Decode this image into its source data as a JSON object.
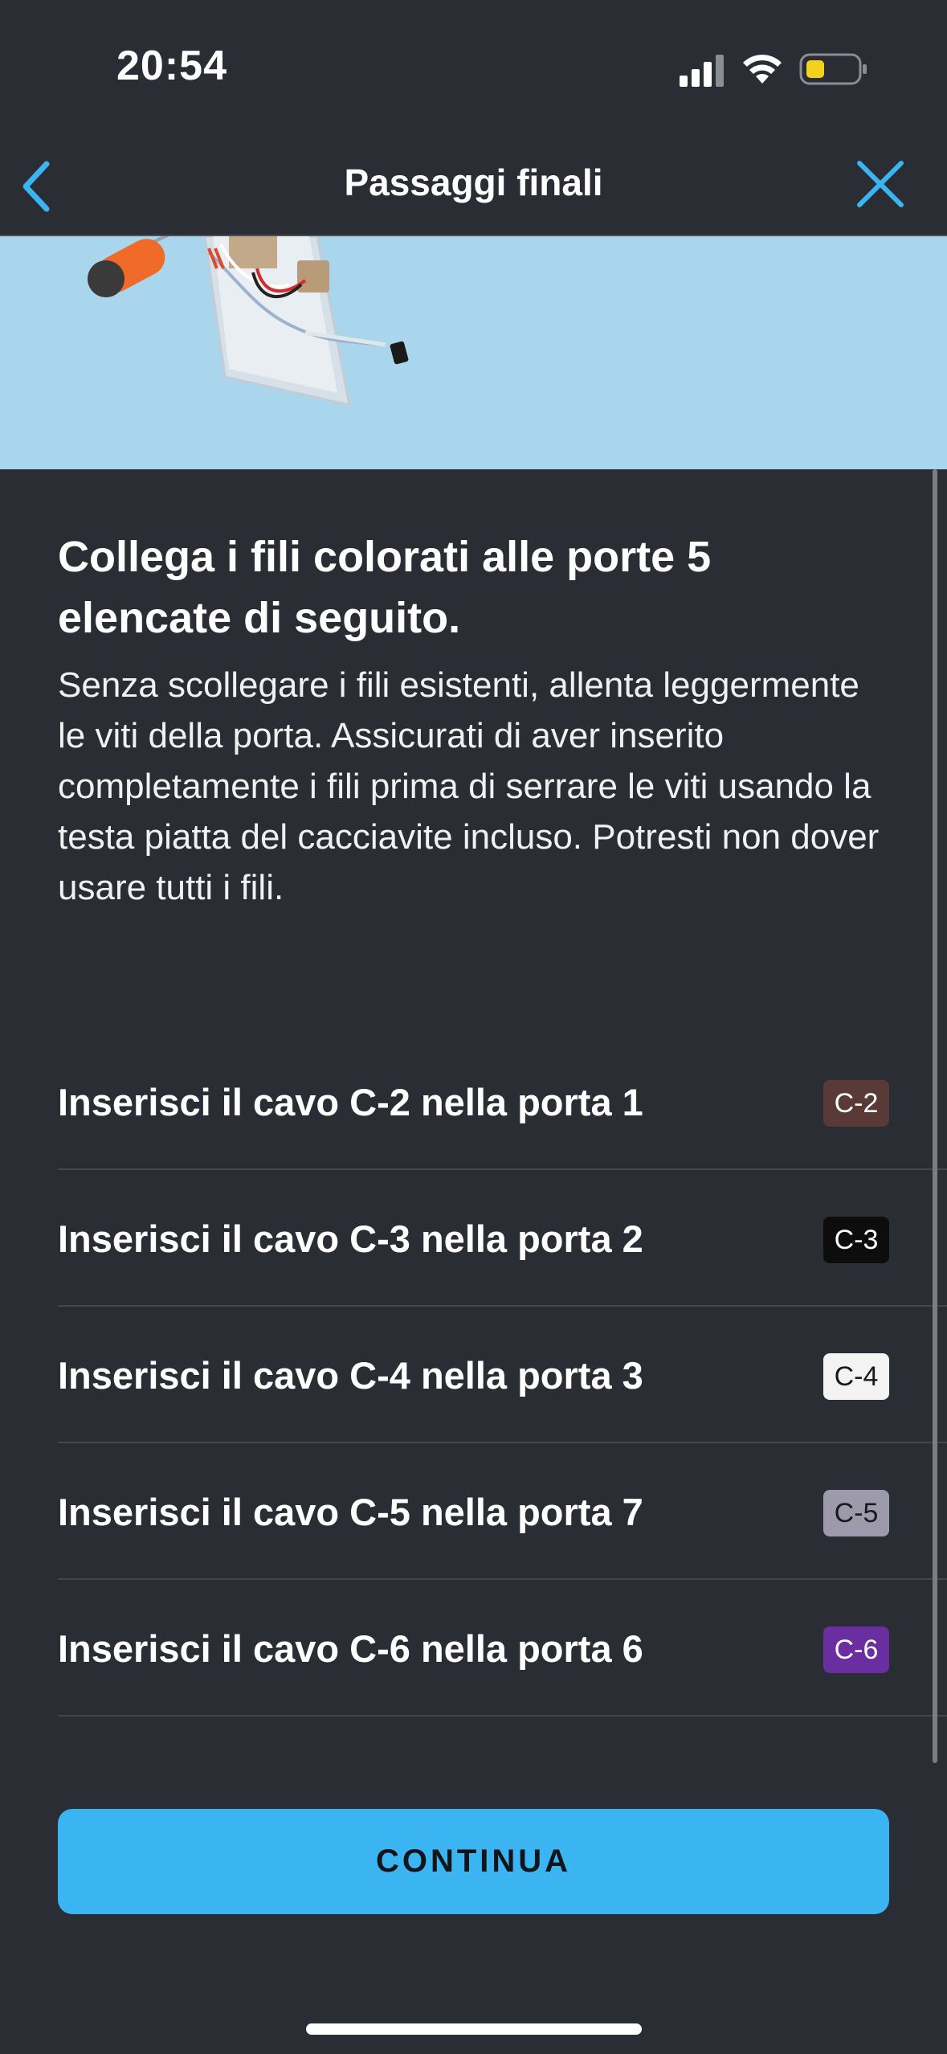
{
  "status_bar": {
    "time": "20:54",
    "battery_color": "#f2d21b"
  },
  "nav": {
    "title": "Passaggi finali",
    "accent": "#3bb5f1",
    "back_icon": "chevron-left-icon",
    "close_icon": "close-icon"
  },
  "content": {
    "heading": "Collega i fili colorati alle porte 5 elencate di seguito.",
    "description": "Senza scollegare i fili esistenti, allenta leggermente le viti della porta. Assicurati di aver inserito completamente i fili prima di serrare le viti usando la testa piatta del cacciavite incluso. Potresti non dover usare tutti i fili."
  },
  "wires": [
    {
      "text": "Inserisci il cavo C-2 nella porta 1",
      "badge": "C-2",
      "badge_bg": "#5a3a36",
      "badge_fg": "#ffffff"
    },
    {
      "text": "Inserisci il cavo C-3 nella porta 2",
      "badge": "C-3",
      "badge_bg": "#0d0d0d",
      "badge_fg": "#ffffff"
    },
    {
      "text": "Inserisci il cavo C-4 nella porta 3",
      "badge": "C-4",
      "badge_bg": "#f3f3f3",
      "badge_fg": "#1a1a1a"
    },
    {
      "text": "Inserisci il cavo C-5 nella porta 7",
      "badge": "C-5",
      "badge_bg": "#9d9aab",
      "badge_fg": "#1a1a1a"
    },
    {
      "text": "Inserisci il cavo C-6 nella porta 6",
      "badge": "C-6",
      "badge_bg": "#6a2ea0",
      "badge_fg": "#ffffff"
    }
  ],
  "continue_label": "CONTINUA"
}
